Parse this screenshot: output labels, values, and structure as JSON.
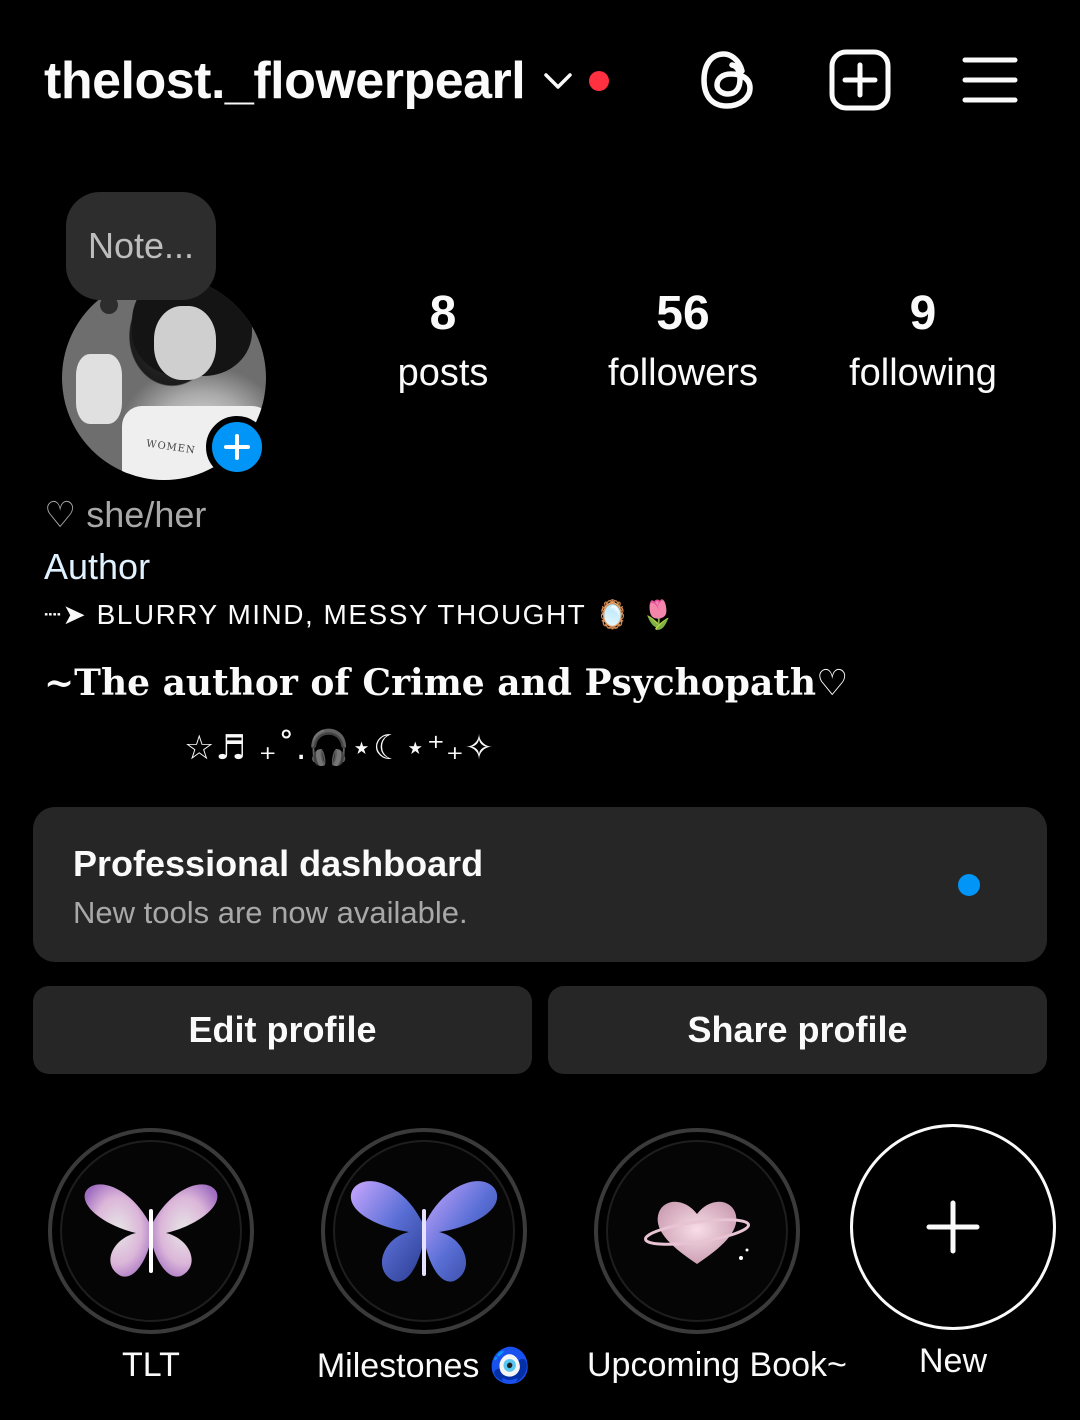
{
  "header": {
    "username": "thelost._flowerpearl",
    "icons": [
      "chevron-down-icon",
      "threads-icon",
      "create-plus-icon",
      "menu-icon"
    ],
    "notification_dot_color": "#ff3040"
  },
  "note": {
    "placeholder": "Note..."
  },
  "stats": [
    {
      "value": "8",
      "label": "posts"
    },
    {
      "value": "56",
      "label": "followers"
    },
    {
      "value": "9",
      "label": "following"
    }
  ],
  "bio": {
    "pronouns": "♡ she/her",
    "category": "Author",
    "tagline": "┈➤ BLURRY MIND, MESSY THOUGHT 🪞 🌷",
    "line": "~The author of Crime and Psychopath♡",
    "symbols": "☆♬ ₊˚.🎧⋆☾⋆⁺₊✧"
  },
  "dashboard": {
    "title": "Professional dashboard",
    "subtitle": "New tools are now available.",
    "dot_color": "#0095f6"
  },
  "buttons": {
    "edit": "Edit profile",
    "share": "Share profile"
  },
  "highlights": [
    {
      "label": "TLT",
      "icon": "butterfly-pink-icon"
    },
    {
      "label": "Milestones 🧿",
      "icon": "butterfly-blue-icon"
    },
    {
      "label": "Upcoming Book~",
      "icon": "heart-planet-icon"
    },
    {
      "label": "New",
      "icon": "plus-icon"
    }
  ],
  "colors": {
    "background": "#000000",
    "surface": "#262626",
    "accent_blue": "#0095f6",
    "text_primary": "#fafafa",
    "text_secondary": "#a8a8a8"
  }
}
